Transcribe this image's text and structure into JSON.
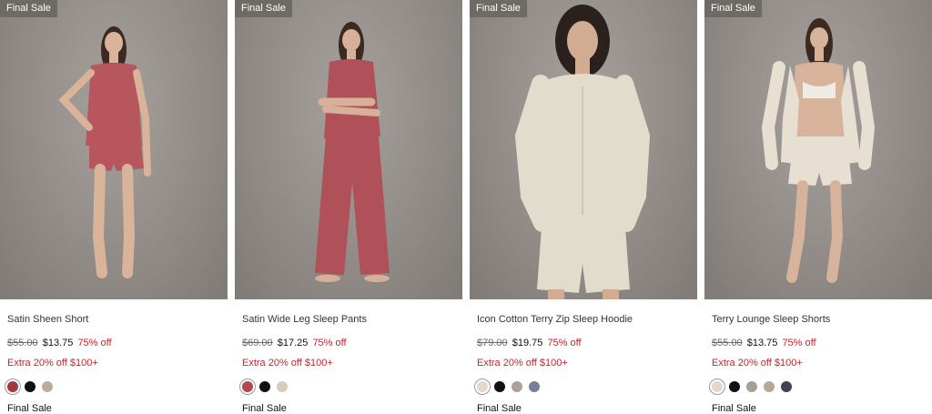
{
  "products": [
    {
      "badge": "Final Sale",
      "name": "Satin Sheen Short",
      "original_price": "$55.00",
      "sale_price": "$13.75",
      "discount": "75% off",
      "promo": "Extra 20% off $100+",
      "swatches": [
        "#a1393d",
        "#111111",
        "#b9ad9f"
      ],
      "final_label": "Final Sale",
      "image_icon": "model-satin-short",
      "colors": {
        "garment": "#b7575d",
        "skin": "#d9b49a",
        "hair": "#3a2a22"
      }
    },
    {
      "badge": "Final Sale",
      "name": "Satin Wide Leg Sleep Pants",
      "original_price": "$69.00",
      "sale_price": "$17.25",
      "discount": "75% off",
      "promo": "Extra 20% off $100+",
      "swatches": [
        "#b2474d",
        "#111111",
        "#d7cbbd"
      ],
      "final_label": "Final Sale",
      "image_icon": "model-wide-leg-pants",
      "colors": {
        "garment": "#b05058",
        "skin": "#d7b09a",
        "hair": "#3a2a22"
      }
    },
    {
      "badge": "Final Sale",
      "name": "Icon Cotton Terry Zip Sleep Hoodie",
      "original_price": "$79.00",
      "sale_price": "$19.75",
      "discount": "75% off",
      "promo": "Extra 20% off $100+",
      "swatches": [
        "#e1dacc",
        "#111111",
        "#a9a29c",
        "#7a7f94"
      ],
      "final_label": "Final Sale",
      "image_icon": "model-zip-hoodie",
      "colors": {
        "garment": "#e2dccd",
        "skin": "#d2ac92",
        "hair": "#2b211c"
      }
    },
    {
      "badge": "Final Sale",
      "name": "Terry Lounge Sleep Shorts",
      "original_price": "$55.00",
      "sale_price": "$13.75",
      "discount": "75% off",
      "promo": "Extra 20% off $100+",
      "swatches": [
        "#e3d7cd",
        "#111111",
        "#a59f95",
        "#b7aa95",
        "#3f4354"
      ],
      "final_label": "Final Sale",
      "image_icon": "model-lounge-shorts",
      "colors": {
        "garment": "#e6dfd2",
        "skin": "#d6b39a",
        "hair": "#3a2a22"
      }
    }
  ]
}
